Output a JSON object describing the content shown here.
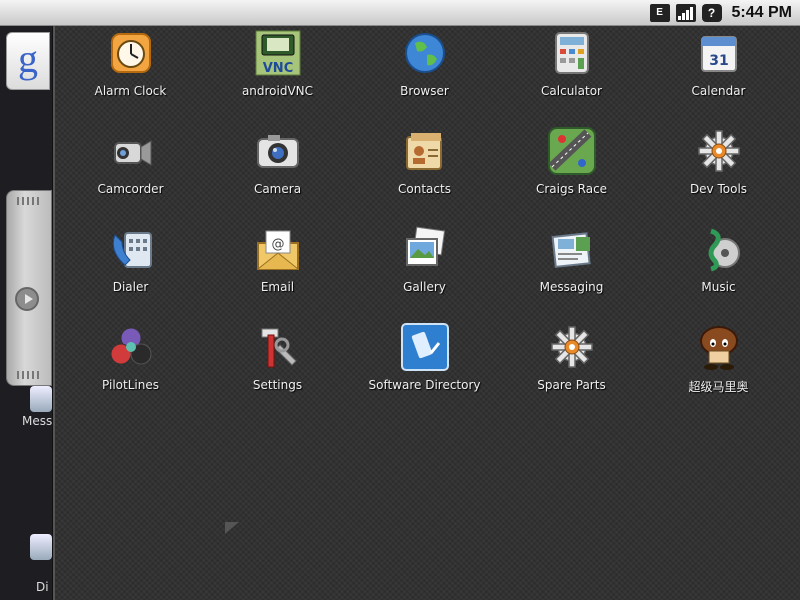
{
  "status_bar": {
    "time": "5:44 PM",
    "icons": [
      "e-data-icon",
      "signal-icon",
      "help-icon"
    ],
    "e_label": "E",
    "help_label": "?"
  },
  "home": {
    "google_glyph": "g",
    "peek_labels": [
      "Mess",
      "Di"
    ]
  },
  "apps": [
    {
      "label": "Alarm Clock",
      "icon": "alarm-clock-icon"
    },
    {
      "label": "androidVNC",
      "icon": "vnc-icon",
      "badge": "VNC"
    },
    {
      "label": "Browser",
      "icon": "globe-icon"
    },
    {
      "label": "Calculator",
      "icon": "calculator-icon"
    },
    {
      "label": "Calendar",
      "icon": "calendar-icon",
      "badge": "31"
    },
    {
      "label": "Camcorder",
      "icon": "camcorder-icon"
    },
    {
      "label": "Camera",
      "icon": "camera-icon"
    },
    {
      "label": "Contacts",
      "icon": "contacts-icon"
    },
    {
      "label": "Craigs Race",
      "icon": "race-track-icon"
    },
    {
      "label": "Dev Tools",
      "icon": "gear-icon"
    },
    {
      "label": "Dialer",
      "icon": "phone-icon"
    },
    {
      "label": "Email",
      "icon": "email-icon",
      "badge": "@"
    },
    {
      "label": "Gallery",
      "icon": "gallery-icon"
    },
    {
      "label": "Messaging",
      "icon": "messaging-icon"
    },
    {
      "label": "Music",
      "icon": "music-icon"
    },
    {
      "label": "PilotLines",
      "icon": "pilotlines-icon"
    },
    {
      "label": "Settings",
      "icon": "settings-tools-icon"
    },
    {
      "label": "Software Directory",
      "icon": "software-directory-icon"
    },
    {
      "label": "Spare Parts",
      "icon": "gear-icon"
    },
    {
      "label": "超级马里奥",
      "icon": "mushroom-character-icon"
    }
  ]
}
